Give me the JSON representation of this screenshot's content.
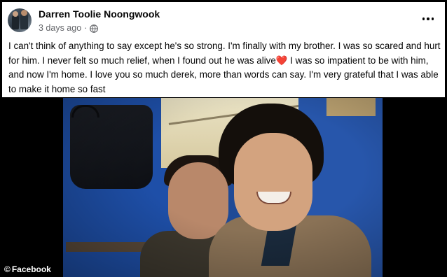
{
  "post": {
    "author": "Darren Toolie Noongwook",
    "timestamp": "3 days ago",
    "separator": "·",
    "audience_icon": "globe-icon",
    "more_icon": "more-options-icon",
    "text_before_emoji": "I can't think of anything to say except he's so strong. I'm finally with my brother. I was so scared and hurt for him. I never felt so much relief, when I found out he was alive",
    "emoji": "❤️",
    "text_after_emoji": " I was so impatient to be with him, and now I'm home. I love you so much derek, more than words can say. I'm very grateful that I was able to make it home so fast"
  },
  "credit": {
    "symbol": "©",
    "source": "Facebook"
  },
  "colors": {
    "author_text": "#050505",
    "secondary_text": "#65676b",
    "heart": "#e0263b"
  }
}
